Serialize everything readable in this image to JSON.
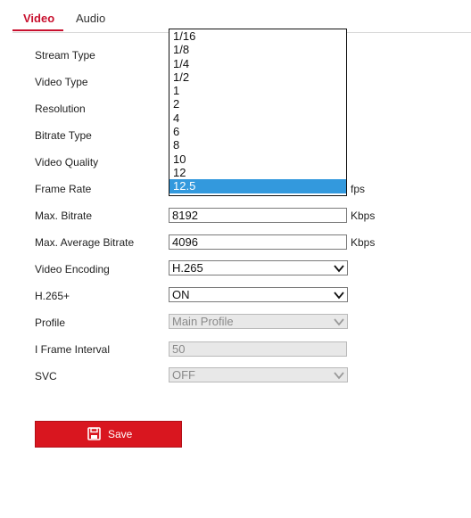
{
  "tabs": {
    "video": "Video",
    "audio": "Audio"
  },
  "fields": {
    "stream_type": "Stream Type",
    "video_type": "Video Type",
    "resolution": "Resolution",
    "bitrate_type": "Bitrate Type",
    "video_quality": "Video Quality",
    "frame_rate": "Frame Rate",
    "max_bitrate": "Max. Bitrate",
    "max_avg_bitrate": "Max. Average Bitrate",
    "video_encoding": "Video Encoding",
    "h265plus": "H.265+",
    "profile": "Profile",
    "i_frame_interval": "I Frame Interval",
    "svc": "SVC"
  },
  "values": {
    "max_bitrate": "8192",
    "max_avg_bitrate": "4096",
    "video_encoding": "H.265",
    "h265plus": "ON",
    "profile": "Main Profile",
    "i_frame_interval": "50",
    "svc": "OFF"
  },
  "units": {
    "fps": "fps",
    "kbps": "Kbps"
  },
  "frame_rate_options": [
    "1/16",
    "1/8",
    "1/4",
    "1/2",
    "1",
    "2",
    "4",
    "6",
    "8",
    "10",
    "12",
    "12.5"
  ],
  "frame_rate_selected": "12.5",
  "buttons": {
    "save": "Save"
  },
  "icons": {
    "save": "save-icon",
    "dropdown": "chevron-down-icon"
  },
  "colors": {
    "accent": "#c8102e",
    "button": "#d9161f",
    "selection": "#3399dd"
  }
}
